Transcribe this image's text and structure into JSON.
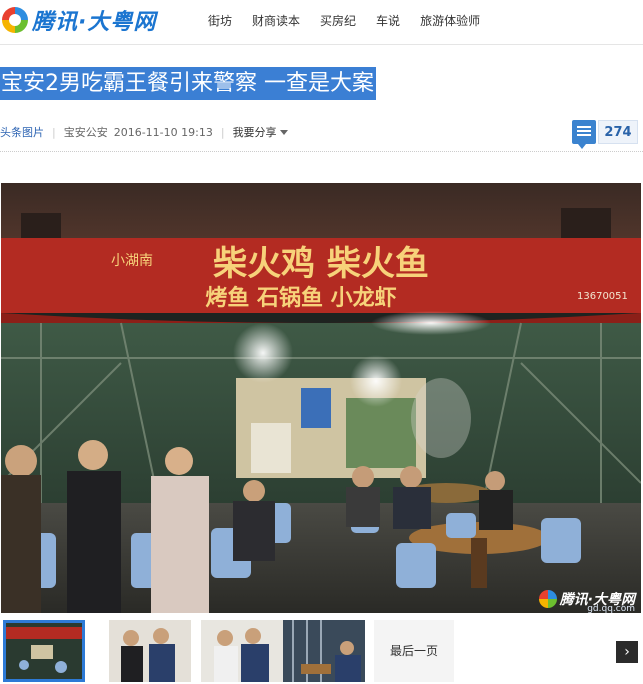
{
  "header": {
    "logo_text": "腾讯·大粤网",
    "nav": [
      "街坊",
      "财商读本",
      "买房纪",
      "车说",
      "旅游体验师"
    ]
  },
  "article": {
    "title": "宝安2男吃霸王餐引来警察 一查是大案",
    "source": "头条图片",
    "author": "宝安公安",
    "datetime": "2016-11-10 19:13",
    "share_label": "我要分享",
    "comment_count": "274"
  },
  "photo": {
    "sign_line1": "柴火鸡  柴火鱼",
    "sign_line2": "烤鱼  石锅鱼  小龙虾",
    "sign_side": "小湖南",
    "sign_phone": "13670051",
    "watermark": "腾讯·大粤网",
    "watermark_sub": "gd.qq.com"
  },
  "gallery": {
    "prev_icon": "chevron-left-icon",
    "next_icon": "chevron-right-icon",
    "last_page_label": "最后一页"
  },
  "colors": {
    "title_highlight": "#3b7fd4",
    "logo_blue": "#1b75d0",
    "active_thumb_border": "#2d7ad6"
  }
}
